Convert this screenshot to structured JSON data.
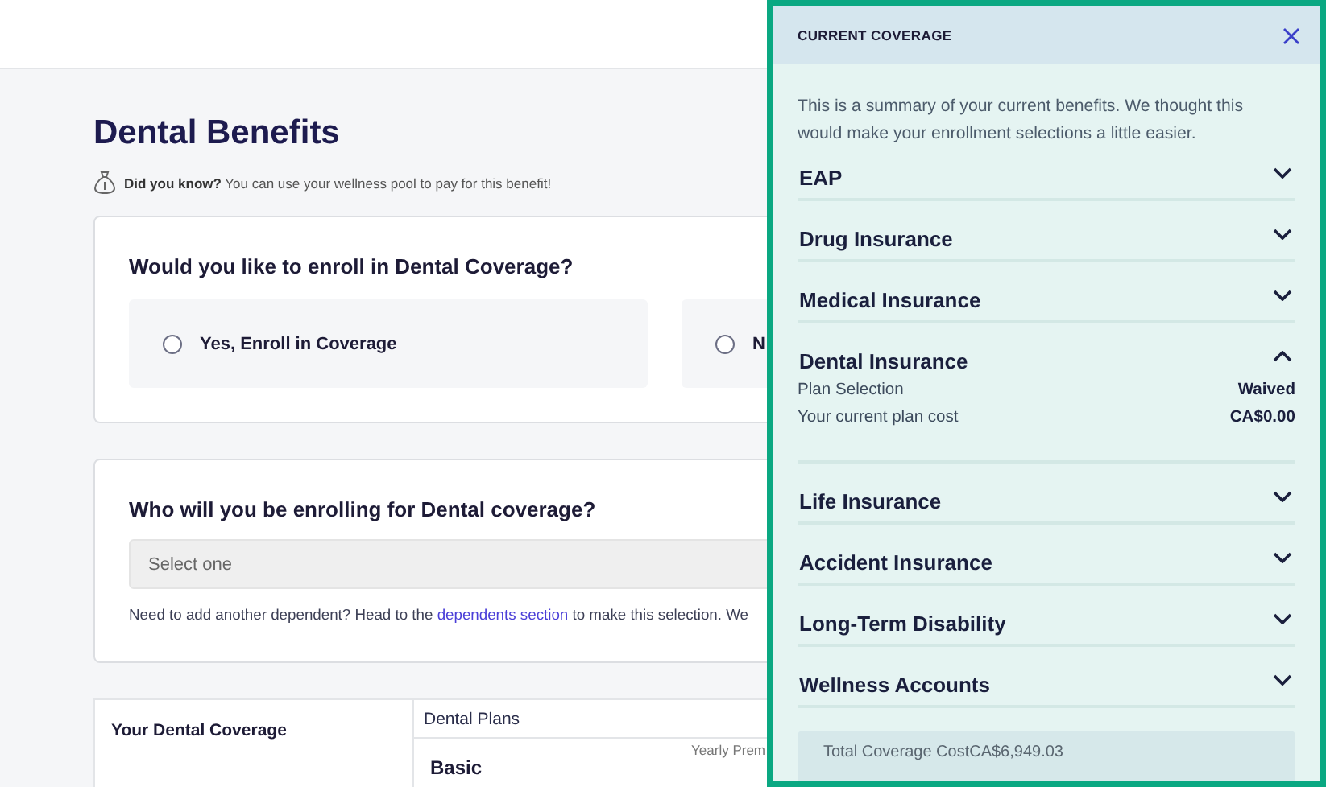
{
  "page": {
    "title": "Dental Benefits",
    "tip": {
      "label": "Did you know?",
      "text": "You can use your wellness pool to pay for this benefit!"
    }
  },
  "enroll_card": {
    "question": "Would you like to enroll in Dental Coverage?",
    "options": [
      {
        "label": "Yes, Enroll in Coverage",
        "selected": false
      },
      {
        "label": "N",
        "selected": false
      }
    ]
  },
  "dependents_card": {
    "question": "Who will you be enrolling for Dental coverage?",
    "select": {
      "placeholder": "Select one"
    },
    "note": {
      "before": "Need to add another dependent? Head to the ",
      "link": "dependents section",
      "after": " to make this selection. We"
    }
  },
  "coverage_table": {
    "side_title": "Your Dental Coverage",
    "column_header": "Dental Plans",
    "plan_name": "Basic",
    "column_3": "Yearly Prem"
  },
  "panel": {
    "title": "CURRENT COVERAGE",
    "intro": "This is a summary of your current benefits. We thought this would make your enrollment selections a little easier.",
    "sections": [
      {
        "title": "EAP",
        "expanded": false
      },
      {
        "title": "Drug Insurance",
        "expanded": false
      },
      {
        "title": "Medical Insurance",
        "expanded": false
      },
      {
        "title": "Dental Insurance",
        "expanded": true,
        "rows": [
          {
            "label": "Plan Selection",
            "value": "Waived"
          },
          {
            "label": "Your current plan cost",
            "value": "CA$0.00"
          }
        ]
      },
      {
        "title": "Life Insurance",
        "expanded": false
      },
      {
        "title": "Accident Insurance",
        "expanded": false
      },
      {
        "title": "Long-Term Disability",
        "expanded": false
      },
      {
        "title": "Wellness Accounts",
        "expanded": false
      }
    ],
    "total": "Total Coverage CostCA$6,949.03"
  }
}
